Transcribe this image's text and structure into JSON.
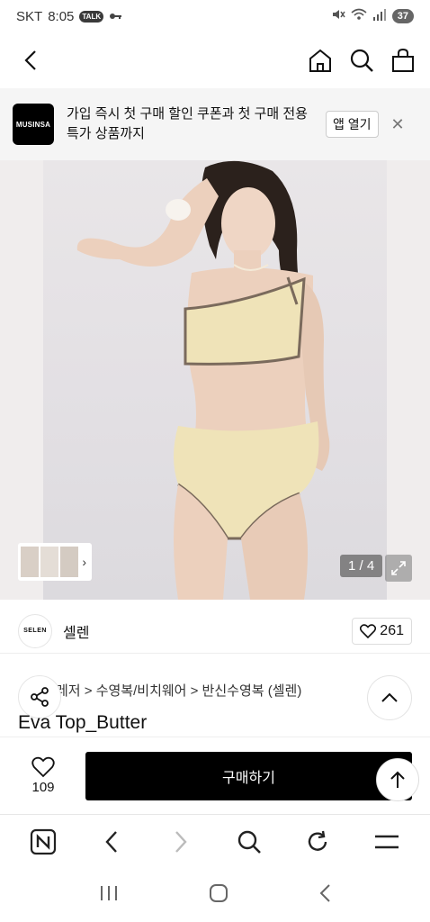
{
  "status": {
    "carrier": "SKT",
    "time": "8:05",
    "talk": "TALK",
    "battery": "37"
  },
  "banner": {
    "logo_text": "MUSINSA",
    "message": "가입 즉시 첫 구매 할인 쿠폰과 첫 구매 전용 특가 상품까지",
    "open_app": "앱 열기",
    "close": "✕"
  },
  "gallery": {
    "counter": "1 / 4"
  },
  "brand": {
    "logo_text": "SELEN",
    "name": "셀렌",
    "likes": "261"
  },
  "product": {
    "breadcrumb": "레저 > 수영복/비치웨어 > 반신수영복 (셀렌)",
    "title": "Eva Top_Butter"
  },
  "buybar": {
    "wish_count": "109",
    "buy_label": "구매하기"
  },
  "colors": {
    "accent": "#000000",
    "banner_bg": "#f5f5f5"
  }
}
